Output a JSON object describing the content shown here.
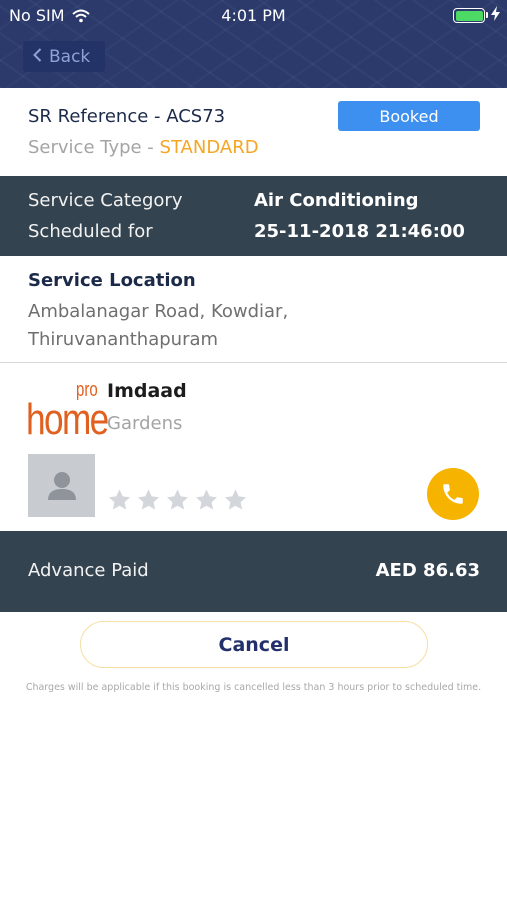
{
  "status_bar": {
    "carrier": "No SIM",
    "time": "4:01 PM"
  },
  "nav": {
    "back_label": "Back"
  },
  "booking": {
    "sr_reference": "SR Reference - ACS73",
    "service_type_label": "Service Type - ",
    "service_type_value": "STANDARD",
    "status": "Booked"
  },
  "details": {
    "category_label": "Service Category",
    "category_value": "Air Conditioning",
    "scheduled_label": "Scheduled for",
    "scheduled_value": "25-11-2018 21:46:00"
  },
  "location": {
    "title": "Service Location",
    "line1": "Ambalanagar Road, Kowdiar,",
    "line2": "Thiruvananthapuram"
  },
  "provider": {
    "logo_text": "home",
    "logo_superscript": "pro",
    "name": "Imdaad",
    "subtitle": "Gardens",
    "rating": 0,
    "rating_max": 5
  },
  "payment": {
    "label": "Advance Paid",
    "value": "AED 86.63"
  },
  "actions": {
    "cancel_label": "Cancel",
    "note": "Charges will be applicable if this booking is cancelled less than 3 hours prior to scheduled time."
  },
  "colors": {
    "header": "#2b3a6b",
    "accent_blue": "#3d8ff0",
    "accent_orange": "#f5a623",
    "dark_band": "#33434f",
    "call_button": "#f6b400"
  }
}
